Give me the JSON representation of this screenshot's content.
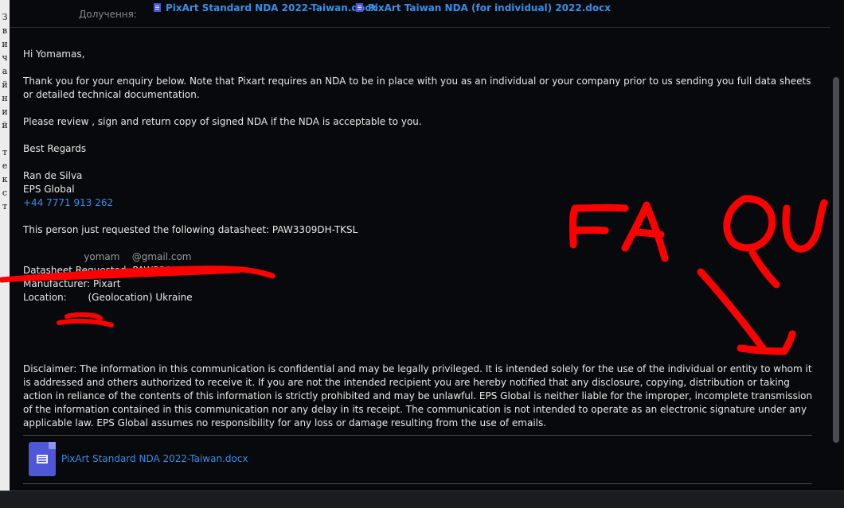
{
  "sidebar": {
    "vertical_text_chars": [
      "З",
      "в",
      "и",
      "ч",
      "а",
      "й",
      "н",
      "и",
      "й",
      "",
      "т",
      "е",
      "к",
      "с",
      "т"
    ]
  },
  "header": {
    "attachments_label": "Долучення:",
    "attachments": [
      {
        "name": "PixArt Standard NDA 2022-Taiwan.docx",
        "icon": "docx-icon"
      },
      {
        "name": "PixArt Taiwan NDA (for individual) 2022.docx",
        "icon": "docx-icon"
      }
    ]
  },
  "message": {
    "greeting": "Hi Yomamas,",
    "paragraph1": "Thank you for your enquiry below. Note that Pixart requires an NDA to be in place with you as an individual or your company prior to us sending you full data sheets or detailed technical documentation.",
    "paragraph2": "Please review , sign and return copy of signed NDA if the NDA is acceptable to you.",
    "closing": "Best Regards",
    "signature": {
      "name": "Ran de Silva",
      "company": "EPS Global",
      "phone": "+44 7771 913 262"
    },
    "request_intro": "This person just requested the following datasheet: PAW3309DH-TKSL",
    "redacted_email": "                    yomam    @gmail.com",
    "datasheet_line": "Datasheet Requested: PAW3309DH-TKSL",
    "manufacturer_line": "Manufacturer: Pixart",
    "location_line": "Location:       (Geolocation) Ukraine",
    "disclaimer": "Disclaimer: The information in this communication is confidential and may be legally privileged. It is intended solely for the use of the individual or entity to whom it is addressed and others authorized to receive it. If you are not the intended recipient you are hereby notified that any disclosure, copying, distribution or taking action in reliance of the contents of this information is strictly prohibited and may be unlawful. EPS Global is neither liable for the improper, incomplete transmission of the information contained in this communication nor any delay in its receipt. The communication is not intended to operate as an electronic signature under any applicable law. EPS Global assumes no responsibility for any loss or damage resulting from the use of emails."
  },
  "attachment_footer": {
    "name": "PixArt Standard NDA 2022-Taiwan.docx",
    "icon": "docx-icon"
  },
  "annotation": {
    "scrawl_text": "FA QU",
    "color": "#ff0000"
  },
  "colors": {
    "background": "#08090c",
    "text": "#e6e6e6",
    "link": "#3a8ee6",
    "doc_icon": "#4f57d8"
  }
}
